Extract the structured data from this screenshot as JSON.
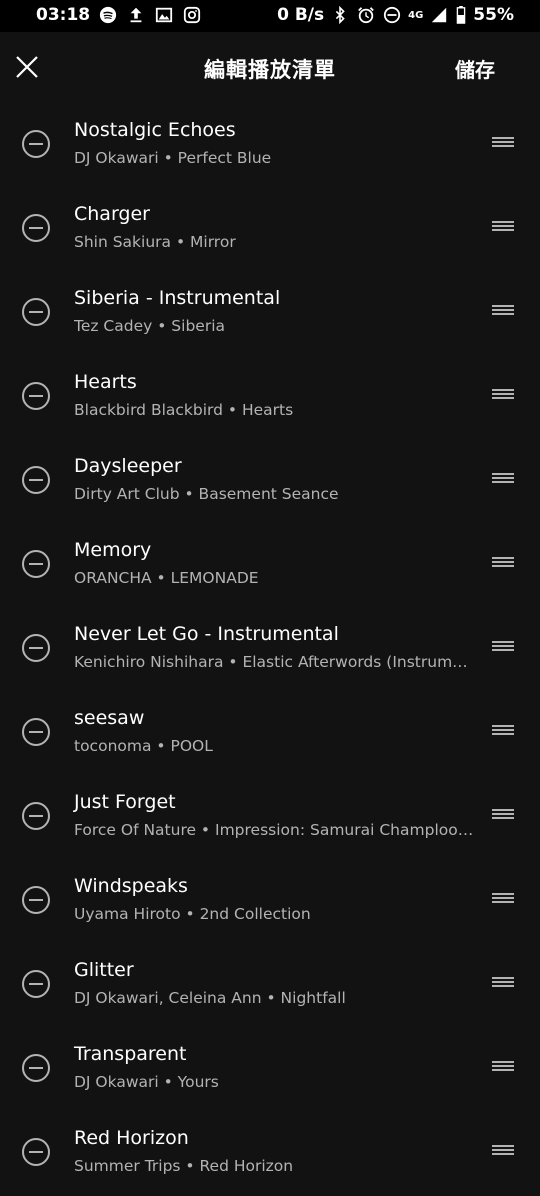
{
  "status_bar": {
    "time": "03:18",
    "left_icons": [
      "spotify-icon",
      "upload-icon",
      "image-icon",
      "instagram-icon"
    ],
    "net_speed": "0 B/s",
    "right_icons": [
      "bluetooth-icon",
      "alarm-icon",
      "dnd-icon",
      "4g-icon",
      "signal-icon",
      "battery-icon"
    ],
    "network": "4G",
    "battery": "55%"
  },
  "header": {
    "title": "編輯播放清單",
    "save_label": "儲存"
  },
  "tracks": [
    {
      "title": "Nostalgic Echoes",
      "subtitle": "DJ Okawari • Perfect Blue"
    },
    {
      "title": "Charger",
      "subtitle": "Shin Sakiura • Mirror"
    },
    {
      "title": "Siberia - Instrumental",
      "subtitle": "Tez Cadey • Siberia"
    },
    {
      "title": "Hearts",
      "subtitle": "Blackbird Blackbird • Hearts"
    },
    {
      "title": "Daysleeper",
      "subtitle": "Dirty Art Club • Basement Seance"
    },
    {
      "title": "Memory",
      "subtitle": "ORANCHA • LEMONADE"
    },
    {
      "title": "Never Let Go - Instrumental",
      "subtitle": "Kenichiro Nishihara • Elastic Afterwords (Instrum…"
    },
    {
      "title": "seesaw",
      "subtitle": "toconoma • POOL"
    },
    {
      "title": "Just Forget",
      "subtitle": "Force Of Nature • Impression: Samurai Champloo…"
    },
    {
      "title": "Windspeaks",
      "subtitle": "Uyama Hiroto • 2nd Collection"
    },
    {
      "title": "Glitter",
      "subtitle": "DJ Okawari, Celeina Ann • Nightfall"
    },
    {
      "title": "Transparent",
      "subtitle": "DJ Okawari • Yours"
    },
    {
      "title": "Red Horizon",
      "subtitle": "Summer Trips • Red Horizon"
    }
  ],
  "colors": {
    "background": "#121212",
    "secondary_text": "#b3b3b3"
  }
}
